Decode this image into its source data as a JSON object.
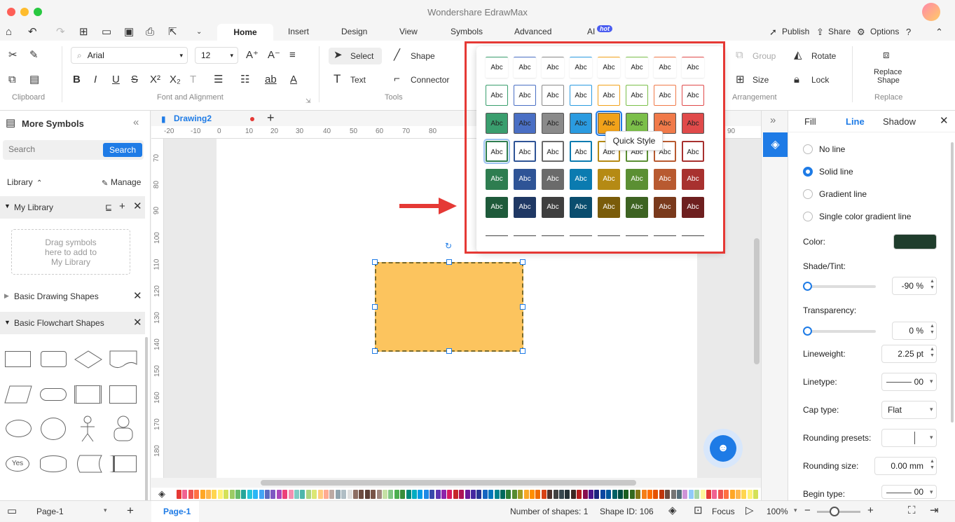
{
  "window": {
    "title": "Wondershare EdrawMax"
  },
  "menu": {
    "tabs": [
      "Home",
      "Insert",
      "Design",
      "View",
      "Symbols",
      "Advanced",
      "AI"
    ],
    "ai_badge": "hot",
    "right": {
      "publish": "Publish",
      "share": "Share",
      "options": "Options"
    }
  },
  "ribbon": {
    "font_name": "Arial",
    "font_size": "12",
    "groups": {
      "clipboard": "Clipboard",
      "font": "Font and Alignment",
      "tools": "Tools",
      "arrangement": "Arrangement",
      "replace": "Replace"
    },
    "tools": {
      "select": "Select",
      "shape": "Shape",
      "text": "Text",
      "connector": "Connector"
    },
    "arrange": {
      "group": "Group",
      "rotate": "Rotate",
      "size": "Size",
      "lock": "Lock"
    },
    "replace_shape": {
      "line1": "Replace",
      "line2": "Shape"
    }
  },
  "left_panel": {
    "title": "More Symbols",
    "search_placeholder": "Search",
    "search_button": "Search",
    "library": "Library",
    "manage": "Manage",
    "my_library": "My Library",
    "drag_hint": [
      "Drag symbols",
      "here to add to",
      "My Library"
    ],
    "sections": [
      "Basic Drawing Shapes",
      "Basic Flowchart Shapes"
    ],
    "yes_label": "Yes"
  },
  "document": {
    "tab_name": "Drawing2",
    "ruler_top": [
      "-20",
      "-10",
      "0",
      "10",
      "20",
      "30",
      "40",
      "50",
      "60",
      "70",
      "80",
      "90"
    ],
    "ruler_top_right": "90",
    "ruler_left": [
      "70",
      "80",
      "90",
      "100",
      "110",
      "120",
      "130",
      "140",
      "150",
      "160",
      "170",
      "180"
    ]
  },
  "quick_style": {
    "tooltip": "Quick Style",
    "cell_text": "Abc",
    "palette": [
      "#3a9e6e",
      "#4a6fc4",
      "#8a8a8a",
      "#2b9be0",
      "#f1a21a",
      "#7cbf4a",
      "#f07a4a",
      "#e04a4a"
    ],
    "dark_palette": [
      "#2e7d50",
      "#2f5496",
      "#6b6b6b",
      "#0b7bb0",
      "#b58a14",
      "#5b8f33",
      "#b85a30",
      "#a8312f"
    ],
    "darker_palette": [
      "#1e5a3a",
      "#1f3864",
      "#3f3f3f",
      "#0a4d6e",
      "#7a5c0a",
      "#3d6322",
      "#7a3a1c",
      "#6e1f1f"
    ]
  },
  "right_panel": {
    "tabs": [
      "Fill",
      "Line",
      "Shadow"
    ],
    "active_tab": "Line",
    "line_options": [
      "No line",
      "Solid line",
      "Gradient line",
      "Single color gradient line"
    ],
    "selected_option": "Solid line",
    "color_label": "Color:",
    "color_value": "#1f3d2c",
    "shade_label": "Shade/Tint:",
    "shade_value": "-90 %",
    "shade_level": -0.9,
    "transparency_label": "Transparency:",
    "transparency_value": "0 %",
    "lineweight_label": "Lineweight:",
    "lineweight_value": "2.25 pt",
    "linetype_label": "Linetype:",
    "linetype_value": "00",
    "cap_label": "Cap type:",
    "cap_value": "Flat",
    "rounding_presets_label": "Rounding presets:",
    "rounding_size_label": "Rounding size:",
    "rounding_size_value": "0.00 mm",
    "begin_type_label": "Begin type:",
    "begin_type_value": "00"
  },
  "status": {
    "page_select": "Page-1",
    "page_tab": "Page-1",
    "num_shapes": "Number of shapes: 1",
    "shape_id": "Shape ID: 106",
    "focus": "Focus",
    "zoom": "100%"
  },
  "colors": {
    "accent": "#1e7be6",
    "shape_fill": "#fcc45e",
    "highlight": "#e53935",
    "arrow": "#e53935"
  }
}
